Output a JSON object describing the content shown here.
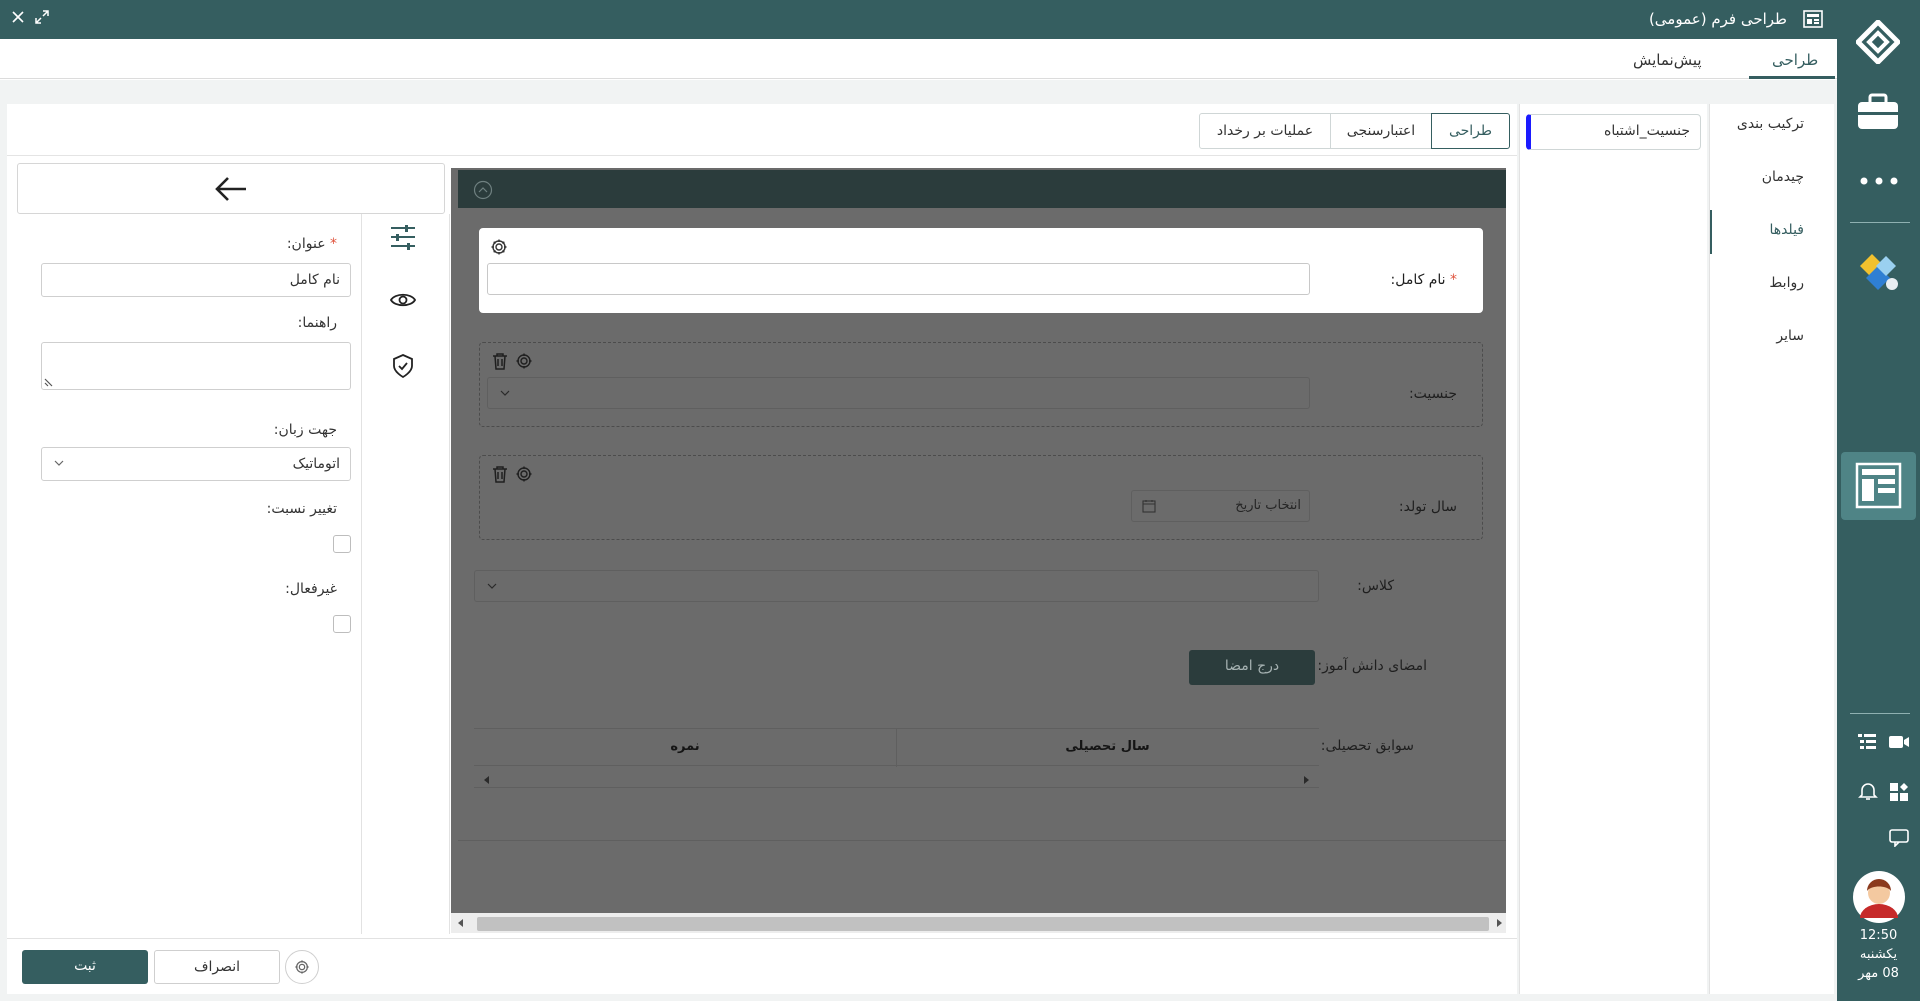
{
  "window": {
    "title": "طراحی فرم (عمومی)"
  },
  "main_tabs": [
    {
      "label": "طراحی",
      "active": true
    },
    {
      "label": "پیش‌نمایش",
      "active": false
    }
  ],
  "right_nav": [
    {
      "label": "ترکیب بندی"
    },
    {
      "label": "چیدمان"
    },
    {
      "label": "فیلدها",
      "active": true
    },
    {
      "label": "روابط"
    },
    {
      "label": "سایر"
    }
  ],
  "field_list": {
    "selected_item": "جنسیت_اشتباه"
  },
  "sub_tabs": [
    {
      "label": "طراحی",
      "active": true
    },
    {
      "label": "اعتبارسنجی"
    },
    {
      "label": "عملیات بر رخداد"
    }
  ],
  "properties": {
    "title_label": "عنوان:",
    "title_value": "نام کامل",
    "hint_label": "راهنما:",
    "direction_label": "جهت زبان:",
    "direction_value": "اتوماتیک",
    "change_ratio_label": "تغییر نسبت:",
    "disabled_label": "غیرفعال:"
  },
  "form_fields": {
    "full_name_label": "نام کامل:",
    "gender_label": "جنسیت:",
    "birth_year_label": "سال تولد:",
    "birth_year_placeholder": "انتخاب تاریخ",
    "class_label": "کلاس:",
    "signature_label": "امضای دانش آموز:",
    "signature_button": "درج امضا",
    "history_label": "سوابق تحصیلی:",
    "history_columns": [
      "سال تحصیلی",
      "نمره"
    ]
  },
  "footer": {
    "save_label": "ثبت",
    "cancel_label": "انصراف"
  },
  "dock": {
    "time": "12:50",
    "day": "یکشنبه",
    "date": "08 مهر"
  },
  "colors": {
    "primary": "#355e60",
    "canvas": "#6b6b6b",
    "required": "#e0533d",
    "field_marker": "#1b1bff"
  }
}
